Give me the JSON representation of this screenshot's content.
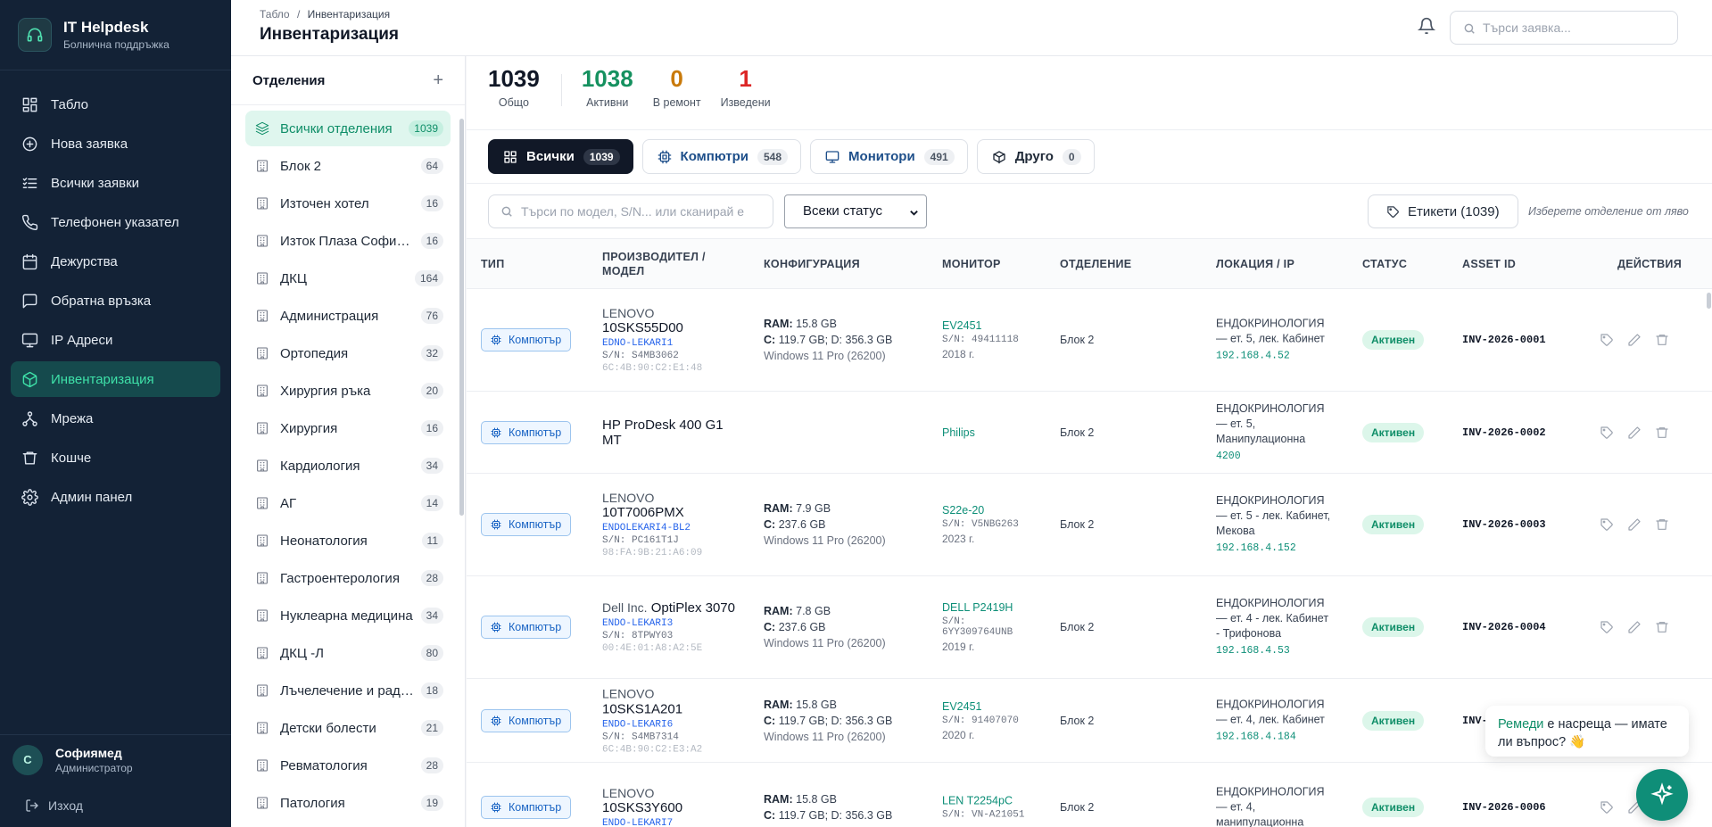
{
  "app": {
    "title": "IT Helpdesk",
    "subtitle": "Болнична поддръжка"
  },
  "nav": [
    {
      "label": "Табло",
      "icon": "dashboard-icon"
    },
    {
      "label": "Нова заявка",
      "icon": "plus-circle-icon"
    },
    {
      "label": "Всички заявки",
      "icon": "list-icon"
    },
    {
      "label": "Телефонен указател",
      "icon": "phone-icon"
    },
    {
      "label": "Дежурства",
      "icon": "calendar-icon"
    },
    {
      "label": "Обратна връзка",
      "icon": "message-icon"
    },
    {
      "label": "IP Адреси",
      "icon": "monitor-icon"
    },
    {
      "label": "Инвентаризация",
      "icon": "box-icon",
      "active": true
    },
    {
      "label": "Мрежа",
      "icon": "network-icon"
    },
    {
      "label": "Кошче",
      "icon": "trash-icon"
    },
    {
      "label": "Админ панел",
      "icon": "gear-icon"
    }
  ],
  "user": {
    "initial": "С",
    "name": "Софиямед",
    "role": "Администратор"
  },
  "logout_label": "Изход",
  "topbar": {
    "breadcrumb_root": "Табло",
    "breadcrumb_sep": "/",
    "breadcrumb_current": "Инвентаризация",
    "page_title": "Инвентаризация",
    "search_placeholder": "Търси заявка..."
  },
  "departments": {
    "title": "Отделения",
    "add_symbol": "+",
    "items": [
      {
        "name": "Всички отделения",
        "count": "1039",
        "active": true
      },
      {
        "name": "Блок 2",
        "count": "64"
      },
      {
        "name": "Източен хотел",
        "count": "16"
      },
      {
        "name": "Изток Плаза Софиям...",
        "count": "16"
      },
      {
        "name": "ДКЦ",
        "count": "164"
      },
      {
        "name": "Администрация",
        "count": "76"
      },
      {
        "name": "Ортопедия",
        "count": "32"
      },
      {
        "name": "Хирургия ръка",
        "count": "20"
      },
      {
        "name": "Хирургия",
        "count": "16"
      },
      {
        "name": "Кардиология",
        "count": "34"
      },
      {
        "name": "АГ",
        "count": "14"
      },
      {
        "name": "Неонатология",
        "count": "11"
      },
      {
        "name": "Гастроентерология",
        "count": "28"
      },
      {
        "name": "Нуклеарна медицина",
        "count": "34"
      },
      {
        "name": "ДКЦ -Л",
        "count": "80"
      },
      {
        "name": "Лъчелечение и ради...",
        "count": "18"
      },
      {
        "name": "Детски болести",
        "count": "21"
      },
      {
        "name": "Ревматология",
        "count": "28"
      },
      {
        "name": "Патология",
        "count": "19"
      }
    ]
  },
  "stats": [
    {
      "value": "1039",
      "label": "Общо",
      "color": "#111827"
    },
    {
      "value": "1038",
      "label": "Активни",
      "color": "#15915f"
    },
    {
      "value": "0",
      "label": "В ремонт",
      "color": "#c97a0b"
    },
    {
      "value": "1",
      "label": "Изведени",
      "color": "#dc2626"
    }
  ],
  "tabs": [
    {
      "label": "Всички",
      "count": "1039",
      "icon": "grid-icon"
    },
    {
      "label": "Компютри",
      "count": "548",
      "icon": "cpu-icon"
    },
    {
      "label": "Монитори",
      "count": "491",
      "icon": "monitor-icon"
    },
    {
      "label": "Друго",
      "count": "0",
      "icon": "package-icon"
    }
  ],
  "filters": {
    "search_placeholder": "Търси по модел, S/N... или сканирай е",
    "status_selected": "Всеки статус",
    "labels_button": "Етикети (1039)",
    "hint": "Изберете отделение от ляво"
  },
  "table": {
    "headers": {
      "type": "ТИП",
      "maker1": "ПРОИЗВОДИТЕЛ /",
      "maker2": "МОДЕЛ",
      "config": "КОНФИГУРАЦИЯ",
      "monitor": "МОНИТОР",
      "dept": "ОТДЕЛЕНИЕ",
      "loc": "ЛОКАЦИЯ / IP",
      "status": "СТАТУС",
      "asset": "ASSET ID",
      "actions": "ДЕЙСТВИЯ"
    },
    "rows": [
      {
        "type": "Компютър",
        "maker": "LENOVO",
        "model": "10SKS55D00",
        "host": "EDNO-LEKARI1",
        "sn": "S/N: S4MB3062",
        "mac": "6C:4B:90:C2:E1:48",
        "ram": "15.8 GB",
        "disk": "119.7 GB; D: 356.3 GB",
        "os": "Windows 11 Pro (26200)",
        "monitor": "EV2451",
        "mon_sn": "S/N: 49411118",
        "mon_year": "2018 г.",
        "dept": "Блок 2",
        "loc": "ЕНДОКРИНОЛОГИЯ — ет. 5, лек. Кабинет",
        "ip": "192.168.4.52",
        "status": "Активен",
        "asset": "INV-2026-0001"
      },
      {
        "type": "Компютър",
        "maker": "",
        "model": "HP ProDesk 400 G1 MT",
        "host": "",
        "sn": "",
        "mac": "",
        "ram": "",
        "disk": "",
        "os": "",
        "monitor": "Philips",
        "mon_sn": "",
        "mon_year": "",
        "dept": "Блок 2",
        "loc": "ЕНДОКРИНОЛОГИЯ — ет. 5, Манипулационна",
        "ip": "4200",
        "status": "Активен",
        "asset": "INV-2026-0002"
      },
      {
        "type": "Компютър",
        "maker": "LENOVO",
        "model": "10T7006PMX",
        "host": "ENDOLEKARI4-BL2",
        "sn": "S/N: PC161T1J",
        "mac": "98:FA:9B:21:A6:09",
        "ram": "7.9 GB",
        "disk": "237.6 GB",
        "os": "Windows 11 Pro (26200)",
        "monitor": "S22e-20",
        "mon_sn": "S/N: V5NBG263",
        "mon_year": "2023 г.",
        "dept": "Блок 2",
        "loc": "ЕНДОКРИНОЛОГИЯ — ет. 5 - лек. Кабинет, Мекова",
        "ip": "192.168.4.152",
        "status": "Активен",
        "asset": "INV-2026-0003"
      },
      {
        "type": "Компютър",
        "maker": "Dell Inc.",
        "model": "OptiPlex 3070",
        "host": "ENDO-LEKARI3",
        "sn": "S/N: 8TPWY03",
        "mac": "00:4E:01:A8:A2:5E",
        "ram": "7.8 GB",
        "disk": "237.6 GB",
        "os": "Windows 11 Pro (26200)",
        "monitor": "DELL P2419H",
        "mon_sn": "S/N: 6YY309764UNB",
        "mon_year": "2019 г.",
        "dept": "Блок 2",
        "loc": "ЕНДОКРИНОЛОГИЯ — ет. 4 - лек. Кабинет - Трифонова",
        "ip": "192.168.4.53",
        "status": "Активен",
        "asset": "INV-2026-0004"
      },
      {
        "type": "Компютър",
        "maker": "LENOVO",
        "model": "10SKS1A201",
        "host": "ENDO-LEKARI6",
        "sn": "S/N: S4MB7314",
        "mac": "6C:4B:90:C2:E3:A2",
        "ram": "15.8 GB",
        "disk": "119.7 GB; D: 356.3 GB",
        "os": "Windows 11 Pro (26200)",
        "monitor": "EV2451",
        "mon_sn": "S/N: 91407070",
        "mon_year": "2020 г.",
        "dept": "Блок 2",
        "loc": "ЕНДОКРИНОЛОГИЯ — ет. 4, лек. Кабинет",
        "ip": "192.168.4.184",
        "status": "Активен",
        "asset": "INV-2026-0005"
      },
      {
        "type": "Компютър",
        "maker": "LENOVO",
        "model": "10SKS3Y600",
        "host": "ENDO-LEKARI7",
        "sn": "",
        "mac": "",
        "ram": "15.8 GB",
        "disk": "119.7 GB; D: 356.3 GB",
        "os": "",
        "monitor": "LEN T2254pC",
        "mon_sn": "S/N: VN-A21051",
        "mon_year": "",
        "dept": "Блок 2",
        "loc": "ЕНДОКРИНОЛОГИЯ — ет. 4, манипулационна",
        "ip": "",
        "status": "Активен",
        "asset": "INV-2026-0006"
      }
    ]
  },
  "assistant": {
    "name": "Ремеди",
    "message": " е насреща — имате ли въпрос? 👋"
  }
}
